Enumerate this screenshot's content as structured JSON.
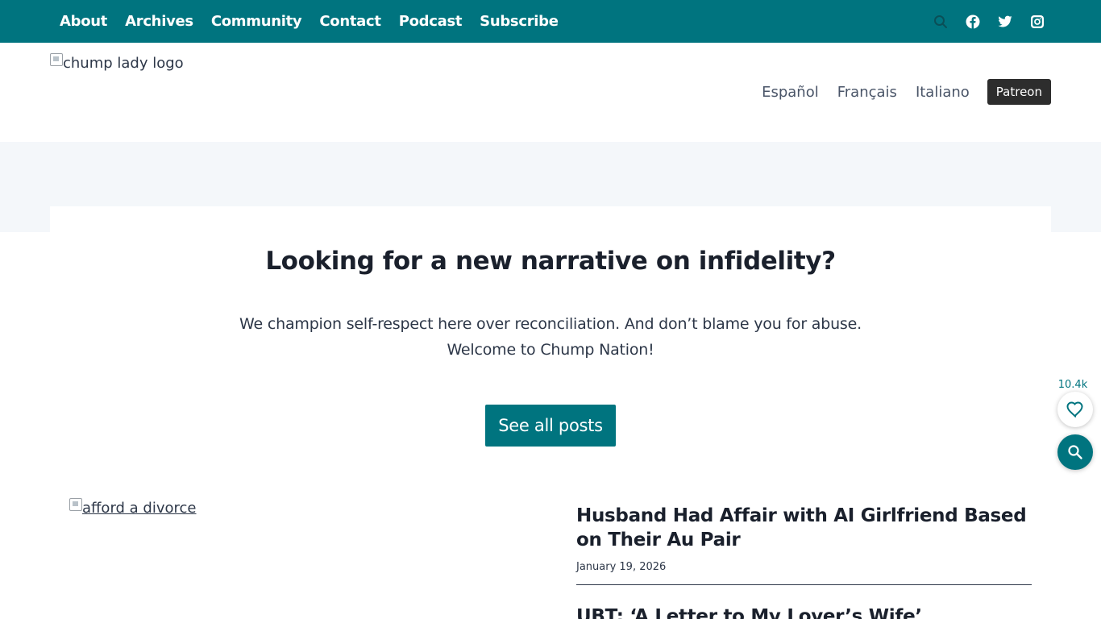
{
  "topnav": {
    "items": [
      "About",
      "Archives",
      "Community",
      "Contact",
      "Podcast",
      "Subscribe"
    ],
    "icons": [
      "search-icon",
      "facebook-icon",
      "twitter-icon",
      "instagram-icon"
    ]
  },
  "header": {
    "logo_alt": "chump lady logo",
    "languages": [
      "Español",
      "Français",
      "Italiano"
    ],
    "patreon_label": "Patreon"
  },
  "hero": {
    "title": "Looking for a new narrative on infidelity?",
    "line1": "We champion self-respect here over reconciliation. And don’t blame you for abuse.",
    "line2": "Welcome to Chump Nation!",
    "cta_label": "See all posts"
  },
  "posts": {
    "image_alt": "afford a divorce",
    "featured_title": "Husband Had Affair with AI Girlfriend Based on Their Au Pair",
    "featured_date": "January 19, 2026",
    "next_title": "UBT: ‘A Letter to My Lover’s Wife’"
  },
  "widgets": {
    "like_count": "10.4k"
  },
  "colors": {
    "brand": "#00747f",
    "hero_bg": "#f4f7fa",
    "patreon_bg": "#2d2d2d"
  }
}
